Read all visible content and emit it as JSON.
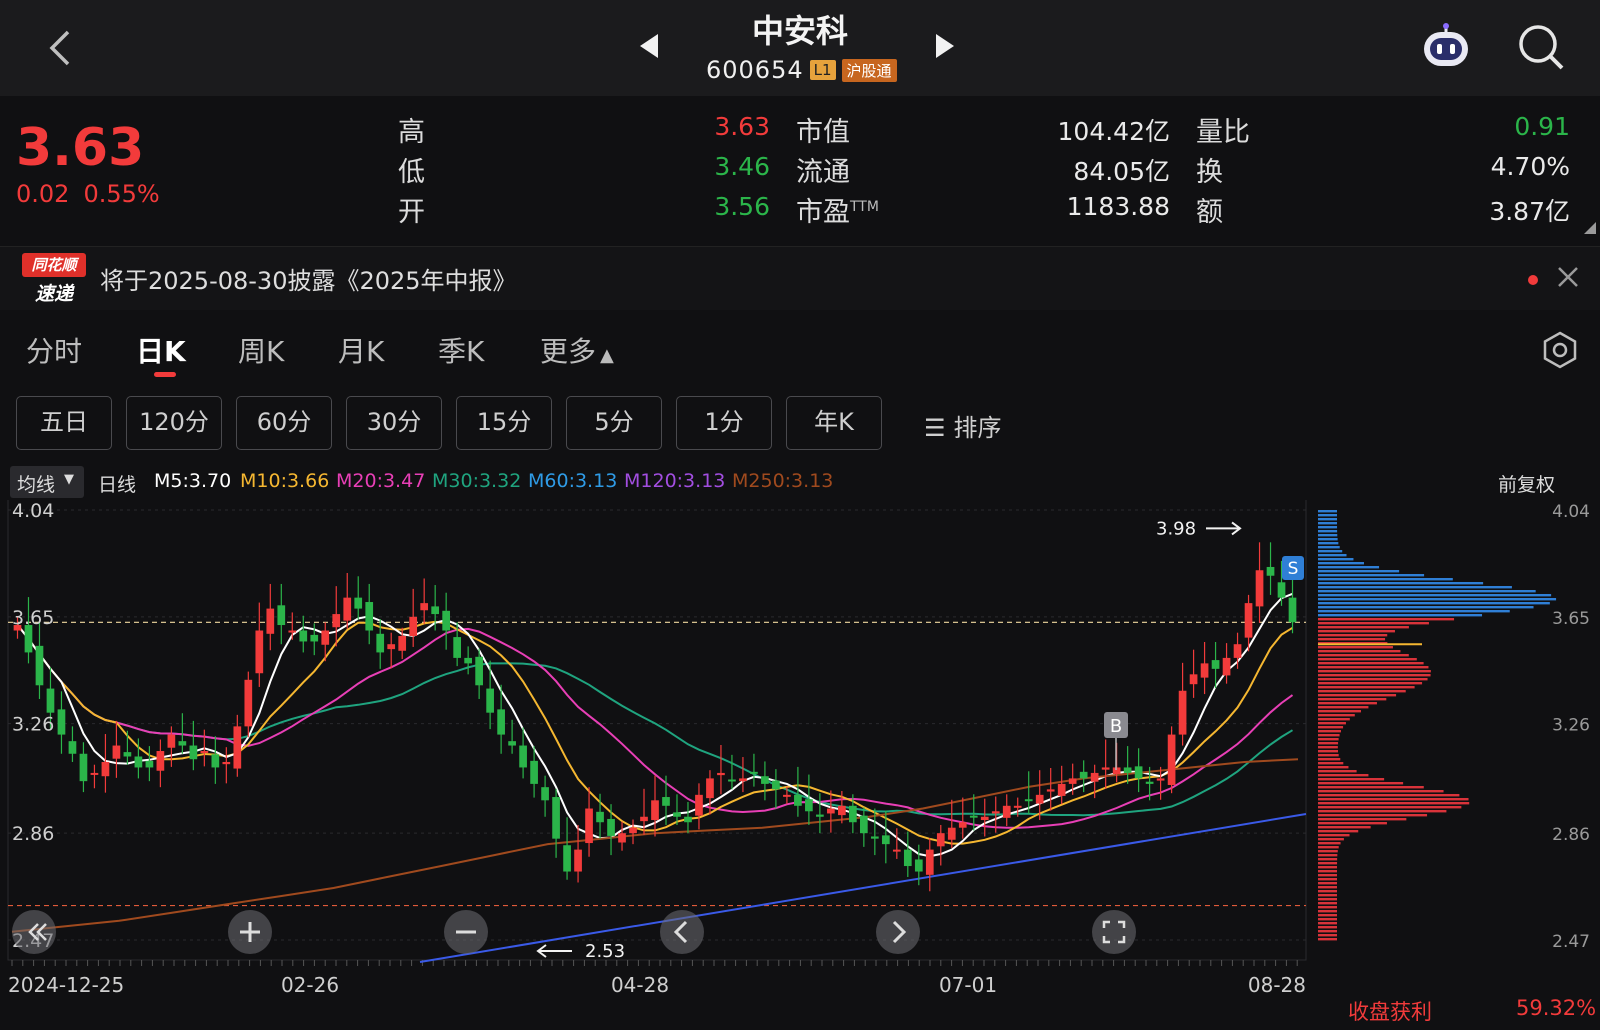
{
  "header": {
    "stock_name": "中安科",
    "stock_code": "600654",
    "tag_level": "L1",
    "tag_connect": "沪股通",
    "icons": [
      "back-chevron-icon",
      "prev-stock-icon",
      "next-stock-icon",
      "robot-assistant-icon",
      "search-icon"
    ]
  },
  "quote": {
    "price": "3.63",
    "change": "0.02",
    "change_pct": "0.55%",
    "high_label": "高",
    "high": "3.63",
    "low_label": "低",
    "low": "3.46",
    "open_label": "开",
    "open": "3.56",
    "mcap_label": "市值",
    "mcap": "104.42亿",
    "float_label": "流通",
    "float": "84.05亿",
    "pe_label": "市盈",
    "pe_sup": "TTM",
    "pe": "1183.88",
    "volratio_label": "量比",
    "volratio": "0.91",
    "turnover_label": "换",
    "turnover": "4.70%",
    "amount_label": "额",
    "amount": "3.87亿",
    "colors": {
      "up": "#f23b3b",
      "down": "#2bb54a"
    }
  },
  "notice": {
    "logo_top": "同花顺",
    "logo_bottom": "速递",
    "text": "将于2025-08-30披露《2025年中报》"
  },
  "period_tabs": [
    "分时",
    "日K",
    "周K",
    "月K",
    "季K",
    "更多"
  ],
  "active_tab": "日K",
  "minute_buttons": [
    "五日",
    "120分",
    "60分",
    "30分",
    "15分",
    "5分",
    "1分",
    "年K"
  ],
  "sort_label": "排序",
  "ma_legend": {
    "selector": "均线",
    "period": "日线",
    "items": [
      {
        "label": "M5:3.70",
        "color": "#ffffff"
      },
      {
        "label": "M10:3.66",
        "color": "#f5b731"
      },
      {
        "label": "M20:3.47",
        "color": "#e83fb6"
      },
      {
        "label": "M30:3.32",
        "color": "#1fa47f"
      },
      {
        "label": "M60:3.13",
        "color": "#2f9be6"
      },
      {
        "label": "M120:3.13",
        "color": "#a24ee0"
      },
      {
        "label": "M250:3.13",
        "color": "#a04a1e"
      }
    ],
    "adjust": "前复权"
  },
  "chart_data": {
    "type": "candlestick",
    "y_ticks": [
      "4.04",
      "3.65",
      "3.26",
      "2.86",
      "2.47"
    ],
    "ylim": [
      2.47,
      4.04
    ],
    "x_ticks": [
      "2024-12-25",
      "02-26",
      "04-28",
      "07-01",
      "08-28"
    ],
    "last_price_line": 3.63,
    "low_marker": "2.53",
    "high_marker": "3.98",
    "buy_marker": "B",
    "sell_marker": "S",
    "closes": [
      3.62,
      3.52,
      3.4,
      3.3,
      3.22,
      3.15,
      3.05,
      3.08,
      3.12,
      3.18,
      3.14,
      3.1,
      3.1,
      3.16,
      3.22,
      3.18,
      3.13,
      3.16,
      3.1,
      3.12,
      3.25,
      3.42,
      3.6,
      3.68,
      3.62,
      3.6,
      3.56,
      3.56,
      3.6,
      3.66,
      3.72,
      3.68,
      3.6,
      3.52,
      3.55,
      3.58,
      3.65,
      3.7,
      3.66,
      3.6,
      3.5,
      3.48,
      3.4,
      3.3,
      3.22,
      3.18,
      3.1,
      3.04,
      2.98,
      2.84,
      2.72,
      2.8,
      2.95,
      2.9,
      2.85,
      2.86,
      2.88,
      2.92,
      2.98,
      2.96,
      2.92,
      2.9,
      3.0,
      3.06,
      3.08,
      3.05,
      3.06,
      3.08,
      3.04,
      3.02,
      3.0,
      2.96,
      2.94,
      2.92,
      2.95,
      2.96,
      2.9,
      2.86,
      2.84,
      2.82,
      2.8,
      2.74,
      2.72,
      2.8,
      2.86,
      2.88,
      2.9,
      2.92,
      2.92,
      2.94,
      2.96,
      2.96,
      2.98,
      3.0,
      3.02,
      3.04,
      3.06,
      3.06,
      3.08,
      3.1,
      3.1,
      3.08,
      3.06,
      3.04,
      3.06,
      3.22,
      3.38,
      3.44,
      3.48,
      3.46,
      3.5,
      3.55,
      3.7,
      3.82,
      3.8,
      3.72,
      3.63
    ],
    "ma_values": {
      "ma250": [
        2.5,
        2.52,
        2.54,
        2.57,
        2.6,
        2.63,
        2.66,
        2.7,
        2.74,
        2.78,
        2.82,
        2.84,
        2.86,
        2.87,
        2.88,
        2.9,
        2.92,
        2.95,
        2.99,
        3.03,
        3.06,
        3.08,
        3.1,
        3.12,
        3.13
      ]
    },
    "volume_profile_split": 3.65,
    "closing_profit_label": "收盘获利",
    "closing_profit": "59.32%"
  },
  "chart_controls": [
    "rewind-icon",
    "zoom-in-icon",
    "zoom-out-icon",
    "scroll-left-icon",
    "scroll-right-icon",
    "fullscreen-icon"
  ]
}
